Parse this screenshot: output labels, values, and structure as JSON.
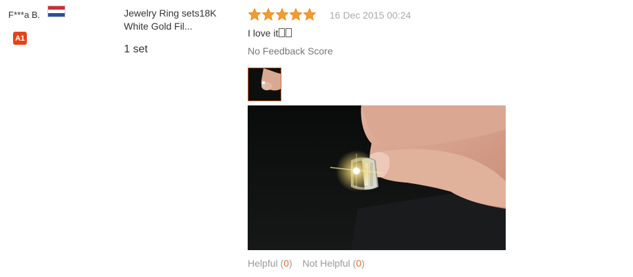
{
  "buyer": {
    "name": "F***a B.",
    "level_badge": "A1",
    "flag_icon": "netherlands-flag-icon"
  },
  "product": {
    "title": "Jewelry Ring sets18K White Gold Fil...",
    "quantity": "1 set"
  },
  "review": {
    "rating": 5,
    "rating_max": 5,
    "date": "16 Dec 2015 00:24",
    "text": "I love it",
    "feedback_score": "No Feedback Score"
  },
  "votes": {
    "helpful_label": "Helpful",
    "helpful_count": "0",
    "not_helpful_label": "Not Helpful",
    "not_helpful_count": "0"
  },
  "colors": {
    "accent": "#e5662d",
    "badge": "#e8421b",
    "star": "#f39c2b",
    "muted_text": "#999999"
  }
}
